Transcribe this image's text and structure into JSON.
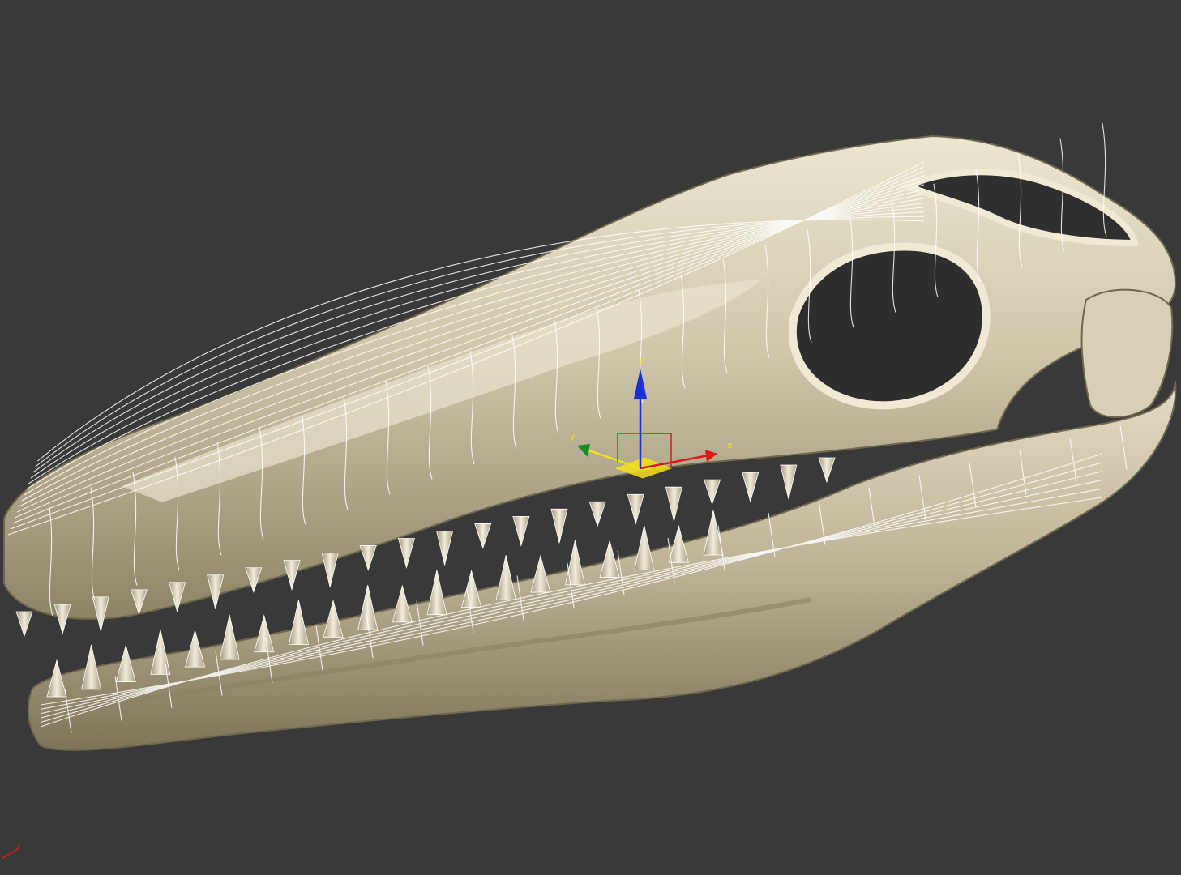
{
  "viewport": {
    "background": "#393939",
    "model": {
      "surface_color": "#c9c0a6",
      "shadow_color": "#7a725c",
      "highlight_color": "#efe9d6",
      "wire_color": "#ffffff"
    }
  },
  "gizmo": {
    "x_label": "x",
    "y_label": "y",
    "z_label": "z",
    "x_color": "#e01818",
    "y_color": "#1c8a1c",
    "z_color": "#1a2fd6",
    "plane_color": "#f2e21a"
  },
  "world_axis_icon": "world-axis-tripod-icon"
}
